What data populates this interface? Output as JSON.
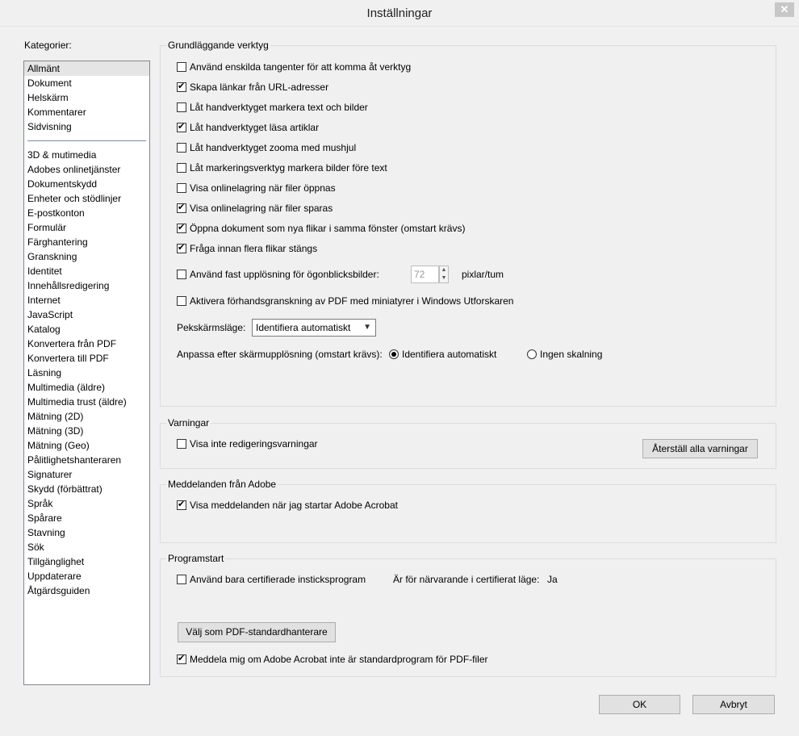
{
  "window": {
    "title": "Inställningar",
    "close_label": "✕"
  },
  "categories": {
    "label": "Kategorier:",
    "top_items": [
      "Allmänt",
      "Dokument",
      "Helskärm",
      "Kommentarer",
      "Sidvisning"
    ],
    "items": [
      "3D & mutimedia",
      "Adobes onlinetjänster",
      "Dokumentskydd",
      "Enheter och stödlinjer",
      "E-postkonton",
      "Formulär",
      "Färghantering",
      "Granskning",
      "Identitet",
      "Innehållsredigering",
      "Internet",
      "JavaScript",
      "Katalog",
      "Konvertera från PDF",
      "Konvertera till PDF",
      "Läsning",
      "Multimedia (äldre)",
      "Multimedia trust (äldre)",
      "Mätning (2D)",
      "Mätning (3D)",
      "Mätning (Geo)",
      "Pålitlighetshanteraren",
      "Signaturer",
      "Skydd (förbättrat)",
      "Språk",
      "Spårare",
      "Stavning",
      "Sök",
      "Tillgänglighet",
      "Uppdaterare",
      "Åtgärdsguiden"
    ],
    "selected": "Allmänt"
  },
  "basic_tools": {
    "title": "Grundläggande verktyg",
    "options": [
      {
        "label": "Använd enskilda tangenter för att komma åt verktyg",
        "checked": false
      },
      {
        "label": "Skapa länkar från URL-adresser",
        "checked": true
      },
      {
        "label": "Låt handverktyget markera text och bilder",
        "checked": false
      },
      {
        "label": "Låt handverktyget läsa artiklar",
        "checked": true
      },
      {
        "label": "Låt handverktyget zooma med mushjul",
        "checked": false
      },
      {
        "label": "Låt markeringsverktyg markera bilder före text",
        "checked": false
      },
      {
        "label": "Visa onlinelagring när filer öppnas",
        "checked": false
      },
      {
        "label": "Visa onlinelagring när filer sparas",
        "checked": true
      },
      {
        "label": "Öppna dokument som nya flikar i samma fönster (omstart krävs)",
        "checked": true
      },
      {
        "label": "Fråga innan flera flikar stängs",
        "checked": true
      }
    ],
    "fixed_resolution": {
      "label": "Använd fast upplösning för ögonblicksbilder:",
      "checked": false,
      "value": "72",
      "unit": "pixlar/tum"
    },
    "preview": {
      "label": "Aktivera förhandsgranskning av PDF med miniatyrer i Windows Utforskaren",
      "checked": false
    },
    "touch_mode": {
      "label": "Pekskärmsläge:",
      "value": "Identifiera automatiskt"
    },
    "scaling": {
      "label": "Anpassa efter skärmupplösning (omstart krävs):",
      "option_auto": "Identifiera automatiskt",
      "option_none": "Ingen skalning",
      "selected": "auto"
    }
  },
  "warnings": {
    "title": "Varningar",
    "option": {
      "label": "Visa inte redigeringsvarningar",
      "checked": false
    },
    "reset_button": "Återställ alla varningar"
  },
  "messages": {
    "title": "Meddelanden från Adobe",
    "option": {
      "label": "Visa meddelanden när jag startar Adobe Acrobat",
      "checked": true
    }
  },
  "startup": {
    "title": "Programstart",
    "certified": {
      "label": "Använd bara certifierade insticksprogram",
      "checked": false
    },
    "cert_mode_label": "Är för närvarande i certifierat läge:",
    "cert_mode_value": "Ja",
    "default_button": "Välj som PDF-standardhanterare",
    "notify": {
      "label": "Meddela mig om Adobe Acrobat inte är standardprogram för PDF-filer",
      "checked": true
    }
  },
  "footer": {
    "ok": "OK",
    "cancel": "Avbryt"
  }
}
